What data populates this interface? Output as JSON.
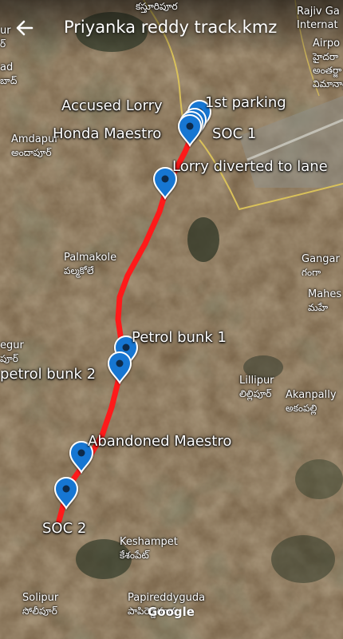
{
  "header": {
    "title": "Priyanka reddy track.kmz"
  },
  "route": {
    "color": "#ff1a1a"
  },
  "markers": [
    {
      "label": "1st parking"
    },
    {
      "label": "Accused Lorry"
    },
    {
      "label": "Honda Maestro"
    },
    {
      "label": "SOC 1"
    },
    {
      "label": "Lorry diverted to lane"
    },
    {
      "label": "Petrol bunk 1"
    },
    {
      "label": "petrol bunk 2"
    },
    {
      "label": "Abandoned Maestro"
    },
    {
      "label": "SOC 2"
    }
  ],
  "places": [
    {
      "en": "Rajiv Ga",
      "te": "Internat"
    },
    {
      "en": "Airpo",
      "te": "హైదరా"
    },
    {
      "en": "",
      "te": "అంతర్జా"
    },
    {
      "en": "",
      "te": "విమానాశ్ర"
    },
    {
      "en": "ur",
      "te": "ర్"
    },
    {
      "en": "ad",
      "te": "బాద్"
    },
    {
      "en": "Amdapur",
      "te": "అందాపూర్"
    },
    {
      "en": "Palmakole",
      "te": "పల్మకోలే"
    },
    {
      "en": "Gangar",
      "te": "గంగా"
    },
    {
      "en": "Mahes",
      "te": "మహే"
    },
    {
      "en": "egur",
      "te": "పూర్"
    },
    {
      "en": "Lillipur",
      "te": "లిల్లిపూర్"
    },
    {
      "en": "Akanpally",
      "te": "అకంపల్లి"
    },
    {
      "en": "Keshampet",
      "te": "కేశంపేట్"
    },
    {
      "en": "Solipur",
      "te": "సోలీపూర్"
    },
    {
      "en": "Papireddyguda",
      "te": "పాపిరెడ్డిగూడ"
    },
    {
      "en": "",
      "te": "కస్తూరిపూర"
    }
  ],
  "attribution": "Google",
  "icons": {
    "back": "arrow-left-icon",
    "marker": "map-pin-icon"
  }
}
